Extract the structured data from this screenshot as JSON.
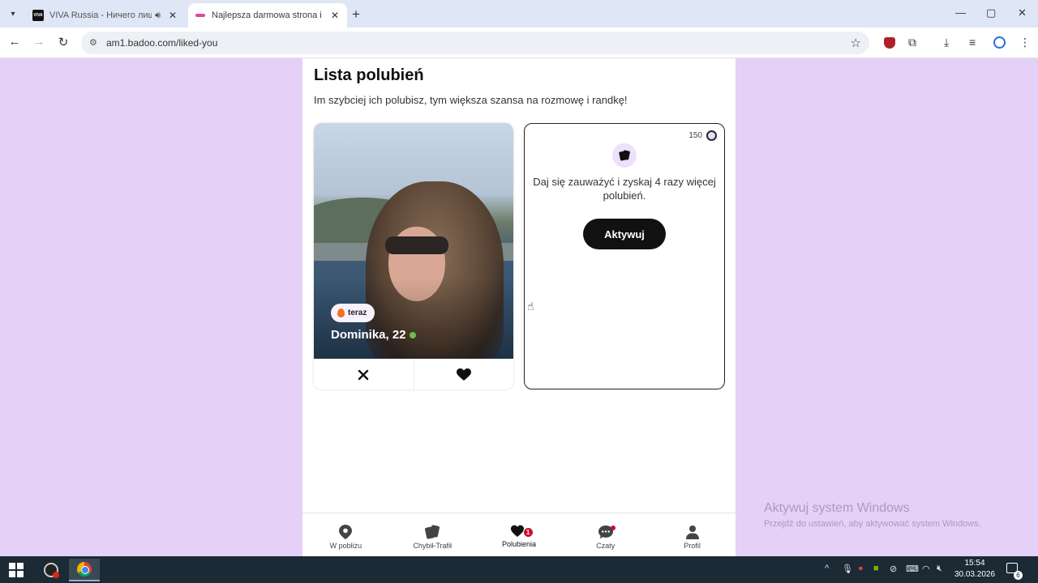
{
  "browser": {
    "tabs": [
      {
        "title": "VIVA Russia - Ничего лишн",
        "favicon": "viva-favicon",
        "audio": true,
        "active": false
      },
      {
        "title": "Najlepsza darmowa strona i ap",
        "favicon": "badoo-favicon",
        "active": true
      }
    ],
    "url": "am1.badoo.com/liked-you",
    "window_controls": {
      "minimize": "—",
      "maximize": "▢",
      "close": "✕"
    }
  },
  "page": {
    "title": "Lista polubień",
    "subtitle": "Im szybciej ich polubisz, tym większa szansa na rozmowę i randkę!",
    "profile_card": {
      "status": "teraz",
      "name": "Dominika, 22",
      "verified": true
    },
    "promo_card": {
      "credits": "150",
      "text": "Daj się zauważyć i zyskaj 4 razy więcej polubień.",
      "button": "Aktywuj"
    }
  },
  "bottom_nav": [
    {
      "label": "W pobliżu",
      "icon": "location-pin-icon",
      "active": false
    },
    {
      "label": "Chybił-Trafił",
      "icon": "cards-icon",
      "active": false
    },
    {
      "label": "Polubienia",
      "icon": "hearts-icon",
      "active": true,
      "badge": "1"
    },
    {
      "label": "Czaty",
      "icon": "chat-bubble-icon",
      "active": false,
      "dot": true
    },
    {
      "label": "Profil",
      "icon": "person-icon",
      "active": false
    }
  ],
  "watermark": {
    "line1": "Aktywuj system Windows",
    "line2": "Przejdź do ustawień, aby aktywować system Windows."
  },
  "taskbar": {
    "time": "15:54",
    "date": "30.03.2026",
    "notification_count": "6"
  },
  "colors": {
    "page_background": "#e5d0f8",
    "accent_badge": "#c8102e",
    "button_dark": "#111111"
  }
}
